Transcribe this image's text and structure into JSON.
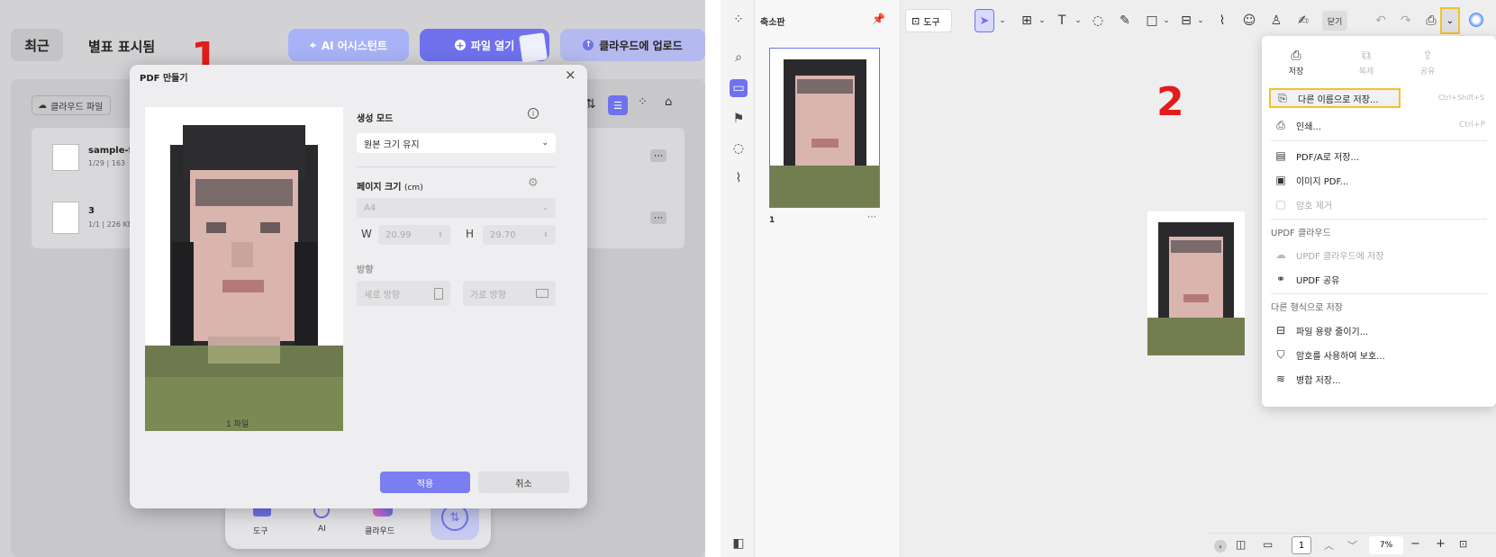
{
  "left": {
    "tab_recent": "최근",
    "tab_starred": "별표 표시됨",
    "btn_ai": "AI 어시스턴트",
    "btn_open": "파일 열기",
    "btn_upload": "클라우드에 업로드",
    "cloud_files": "클라우드 파일",
    "files": [
      {
        "name": "sample-fil",
        "meta": "1/29 | 163"
      },
      {
        "name": "3",
        "meta": "1/1 | 226 KB"
      }
    ],
    "annotation": "1",
    "dock": {
      "tool": "도구",
      "ai": "AI",
      "cloud": "클라우드"
    },
    "dialog": {
      "title": "PDF 만들기",
      "mode_label": "생성 모드",
      "mode_value": "원본 크기 유지",
      "size_label": "페이지 크기",
      "size_unit": "(cm)",
      "paper": "A4",
      "w_label": "W",
      "w_value": "20.99",
      "h_label": "H",
      "h_value": "29.70",
      "orient_label": "방향",
      "portrait": "세로 방향",
      "landscape": "가로 방향",
      "file_count": "1 파일",
      "apply": "적용",
      "cancel": "취소"
    }
  },
  "right": {
    "thumb_title": "축소판",
    "page_num": "1",
    "tool_label": "도구",
    "close_label": "닫기",
    "annotation": "2",
    "menu": {
      "top": [
        {
          "label": "저장",
          "icon": "save-icon",
          "disabled": false
        },
        {
          "label": "복제",
          "icon": "duplicate-icon",
          "disabled": true
        },
        {
          "label": "공유",
          "icon": "share-icon",
          "disabled": true
        }
      ],
      "save_as": "다른 이름으로 저장...",
      "save_as_shortcut": "Ctrl+Shift+S",
      "print": "인쇄...",
      "print_shortcut": "Ctrl+P",
      "pdfa": "PDF/A로 저장...",
      "image_pdf": "이미지 PDF...",
      "remove_pw": "암호 제거",
      "cloud_header": "UPDF 클라우드",
      "cloud_save": "UPDF 클라우드에 저장",
      "share": "UPDF 공유",
      "other_header": "다른 형식으로 저장",
      "reduce": "파일 용량 줄이기...",
      "protect": "암호를 사용하여 보호...",
      "flatten": "병합 저장..."
    },
    "status": {
      "page": "1",
      "zoom": "7%"
    }
  }
}
